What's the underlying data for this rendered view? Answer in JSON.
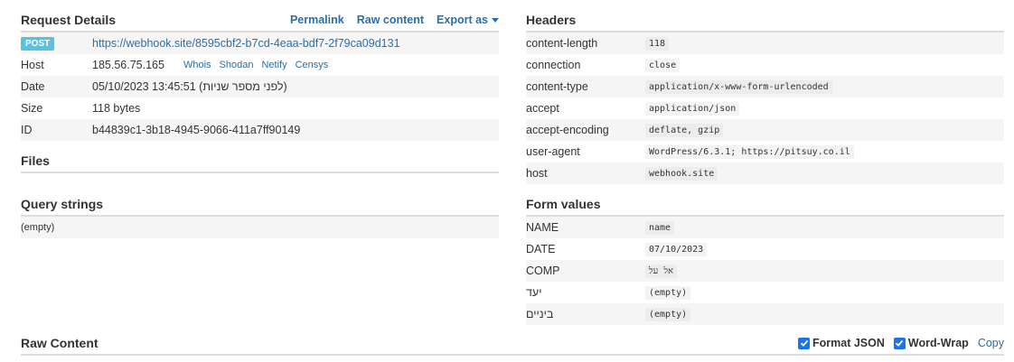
{
  "request_details": {
    "title": "Request Details",
    "actions": {
      "permalink": "Permalink",
      "raw_content": "Raw content",
      "export_as": "Export as"
    },
    "method": "POST",
    "url": "https://webhook.site/8595cbf2-b7cd-4eaa-bdf7-2f79ca09d131",
    "rows": {
      "host": {
        "label": "Host",
        "value": "185.56.75.165"
      },
      "date": {
        "label": "Date",
        "value": "05/10/2023 13:45:51 (לפני מספר שניות)"
      },
      "size": {
        "label": "Size",
        "value": "118 bytes"
      },
      "id": {
        "label": "ID",
        "value": "b44839c1-3b18-4945-9066-411a7ff90149"
      }
    },
    "host_links": [
      "Whois",
      "Shodan",
      "Netify",
      "Censys"
    ]
  },
  "files": {
    "title": "Files"
  },
  "query_strings": {
    "title": "Query strings",
    "empty": "(empty)"
  },
  "headers": {
    "title": "Headers",
    "rows": [
      {
        "key": "content-length",
        "value": "118"
      },
      {
        "key": "connection",
        "value": "close"
      },
      {
        "key": "content-type",
        "value": "application/x-www-form-urlencoded"
      },
      {
        "key": "accept",
        "value": "application/json"
      },
      {
        "key": "accept-encoding",
        "value": "deflate, gzip"
      },
      {
        "key": "user-agent",
        "value": "WordPress/6.3.1; https://pitsuy.co.il"
      },
      {
        "key": "host",
        "value": "webhook.site"
      }
    ]
  },
  "form_values": {
    "title": "Form values",
    "rows": [
      {
        "key": "NAME",
        "value": "name"
      },
      {
        "key": "DATE",
        "value": "07/10/2023"
      },
      {
        "key": "COMP",
        "value": "אל על"
      },
      {
        "key": "יעד",
        "value": "(empty)"
      },
      {
        "key": "ביניים",
        "value": "(empty)"
      }
    ]
  },
  "raw_content": {
    "title": "Raw Content",
    "format_json_label": "Format JSON",
    "format_json_checked": true,
    "word_wrap_label": "Word-Wrap",
    "word_wrap_checked": true,
    "copy_label": "Copy"
  },
  "colors": {
    "link": "#2a6fa8",
    "badge": "#5bc0de",
    "checkbox": "#1a73e8"
  }
}
